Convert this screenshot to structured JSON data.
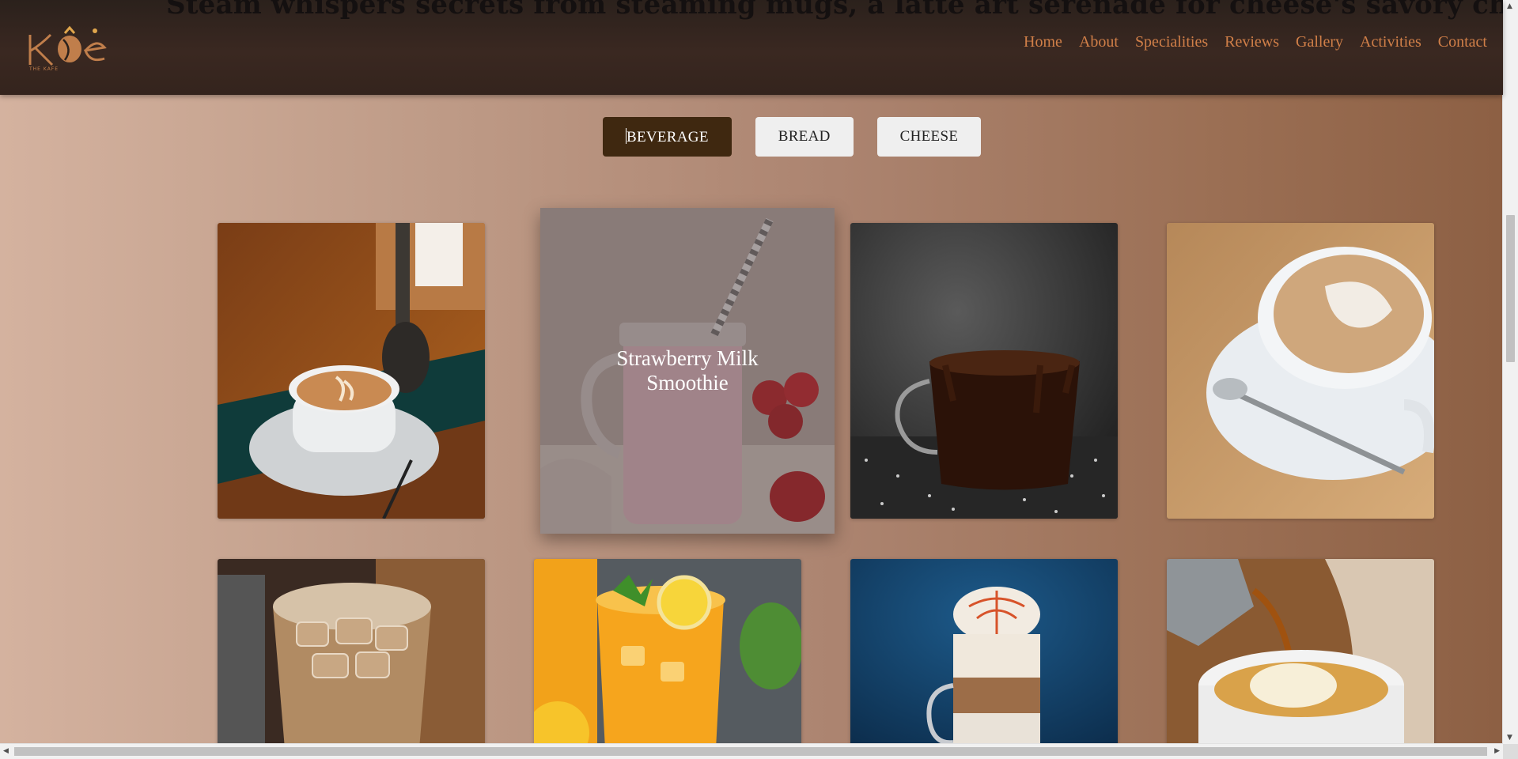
{
  "header": {
    "tagline": "Steam whispers secrets from steaming mugs, a latte art serenade for cheese's savory charm...",
    "logo_text": "Kŏė",
    "logo_subtext": "THE KAFE"
  },
  "nav": {
    "items": [
      {
        "label": "Home"
      },
      {
        "label": "About"
      },
      {
        "label": "Specialities"
      },
      {
        "label": "Reviews"
      },
      {
        "label": "Gallery"
      },
      {
        "label": "Activities"
      },
      {
        "label": "Contact"
      }
    ]
  },
  "filters": {
    "active": "BEVERAGE",
    "items": [
      {
        "label": "BEVERAGE"
      },
      {
        "label": "BREAD"
      },
      {
        "label": "CHEESE"
      }
    ]
  },
  "gallery": {
    "hovered_title": "Strawberry Milk Smoothie",
    "items": [
      {
        "icon": "latte-art-cup-image"
      },
      {
        "icon": "strawberry-smoothie-image"
      },
      {
        "icon": "hot-chocolate-image"
      },
      {
        "icon": "cappuccino-cup-image"
      },
      {
        "icon": "iced-coffee-image"
      },
      {
        "icon": "iced-lemon-tea-image"
      },
      {
        "icon": "layered-latte-image"
      },
      {
        "icon": "affogato-image"
      }
    ]
  },
  "colors": {
    "header_bg": "#3a2821",
    "nav_link": "#d07f48",
    "active_filter": "#3f2810",
    "filter_bg": "#efefef"
  }
}
